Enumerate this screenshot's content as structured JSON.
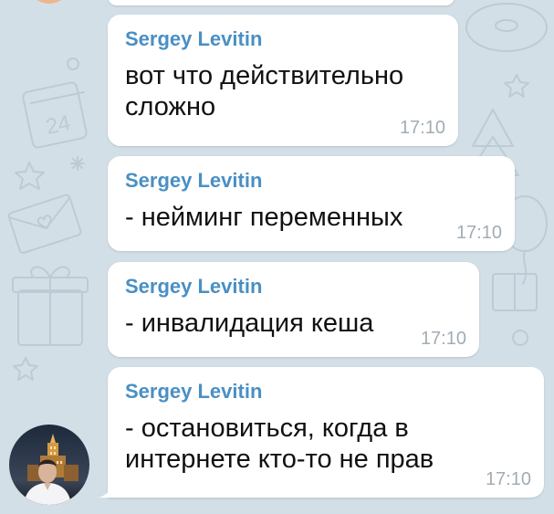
{
  "chat": {
    "messages": [
      {
        "sender": "Sergey Levitin",
        "lines": [
          "вот что действительно",
          "сложно"
        ],
        "time": "17:10"
      },
      {
        "sender": "Sergey Levitin",
        "lines": [
          "- нейминг переменных"
        ],
        "time": "17:10"
      },
      {
        "sender": "Sergey Levitin",
        "lines": [
          "- инвалидация кеша"
        ],
        "time": "17:10"
      },
      {
        "sender": "Sergey Levitin",
        "lines": [
          "- остановиться, когда в",
          "интернете кто-то не прав"
        ],
        "time": "17:10"
      }
    ]
  },
  "colors": {
    "background": "#d3dfe7",
    "bubble": "#ffffff",
    "sender_name": "#4a8fc4",
    "message_text": "#111111",
    "timestamp": "#a3acb3"
  },
  "icons": [
    "calendar-doodle",
    "star-doodle",
    "envelope-doodle",
    "gift-doodle",
    "balloon-doodle",
    "donut-doodle"
  ]
}
